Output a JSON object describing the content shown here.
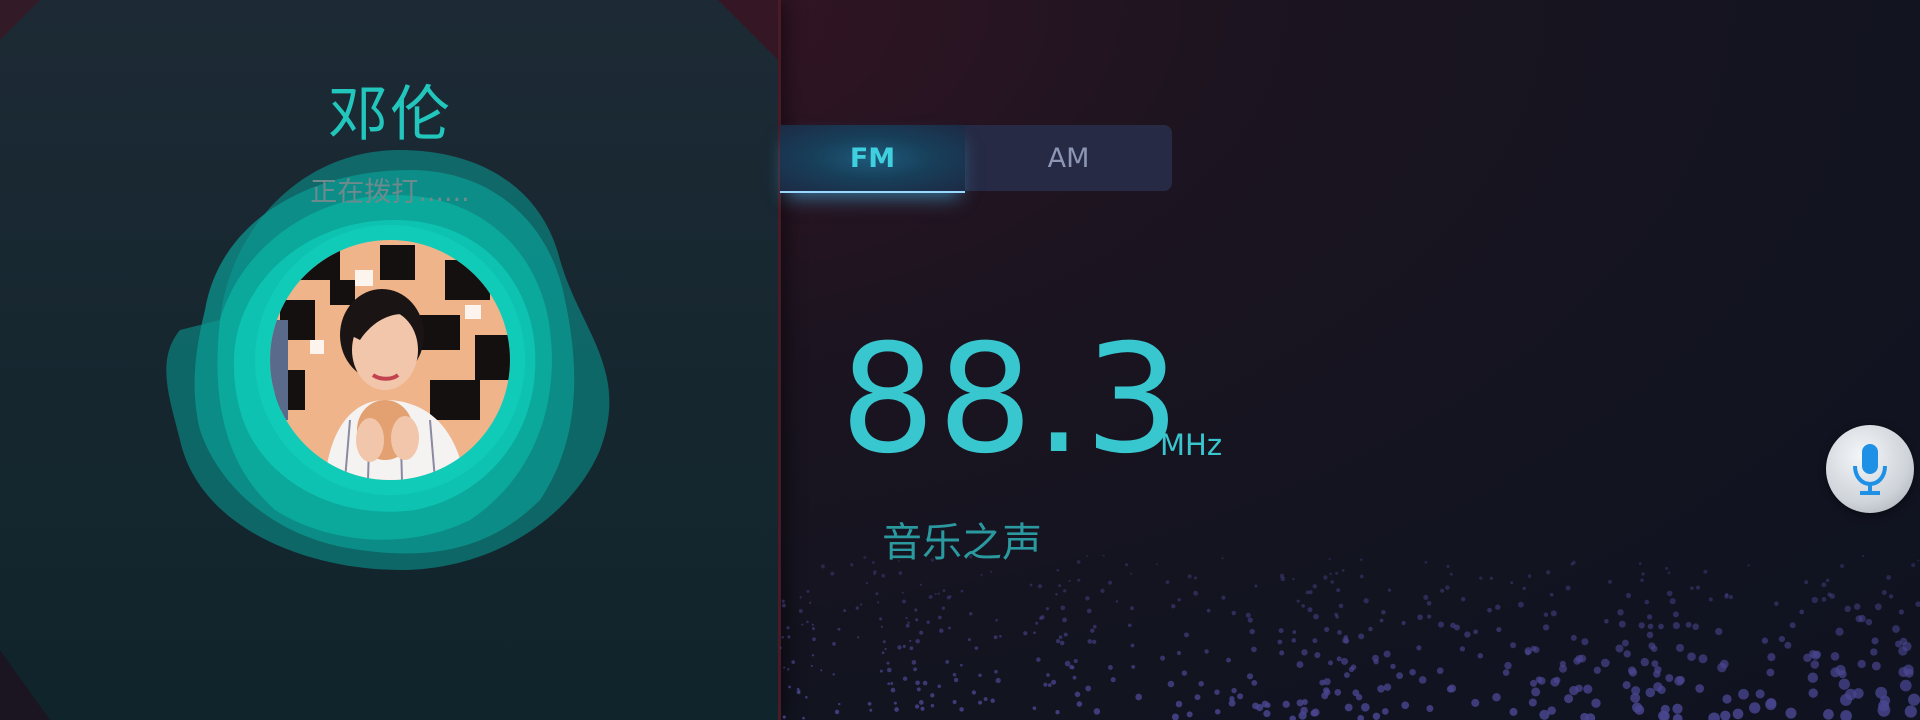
{
  "call": {
    "caller_name": "邓伦",
    "status_text": "正在拨打......"
  },
  "radio": {
    "bands": [
      {
        "label": "FM",
        "active": true
      },
      {
        "label": "AM",
        "active": false
      }
    ],
    "frequency": "88.3",
    "unit": "MHz",
    "station": "音乐之声"
  },
  "icons": {
    "voice_button": "microphone-icon",
    "avatar": "caller-avatar"
  },
  "colors": {
    "accent": "#38c6cf",
    "wave_teal": "#0fc4b4",
    "background": "#14121d"
  }
}
